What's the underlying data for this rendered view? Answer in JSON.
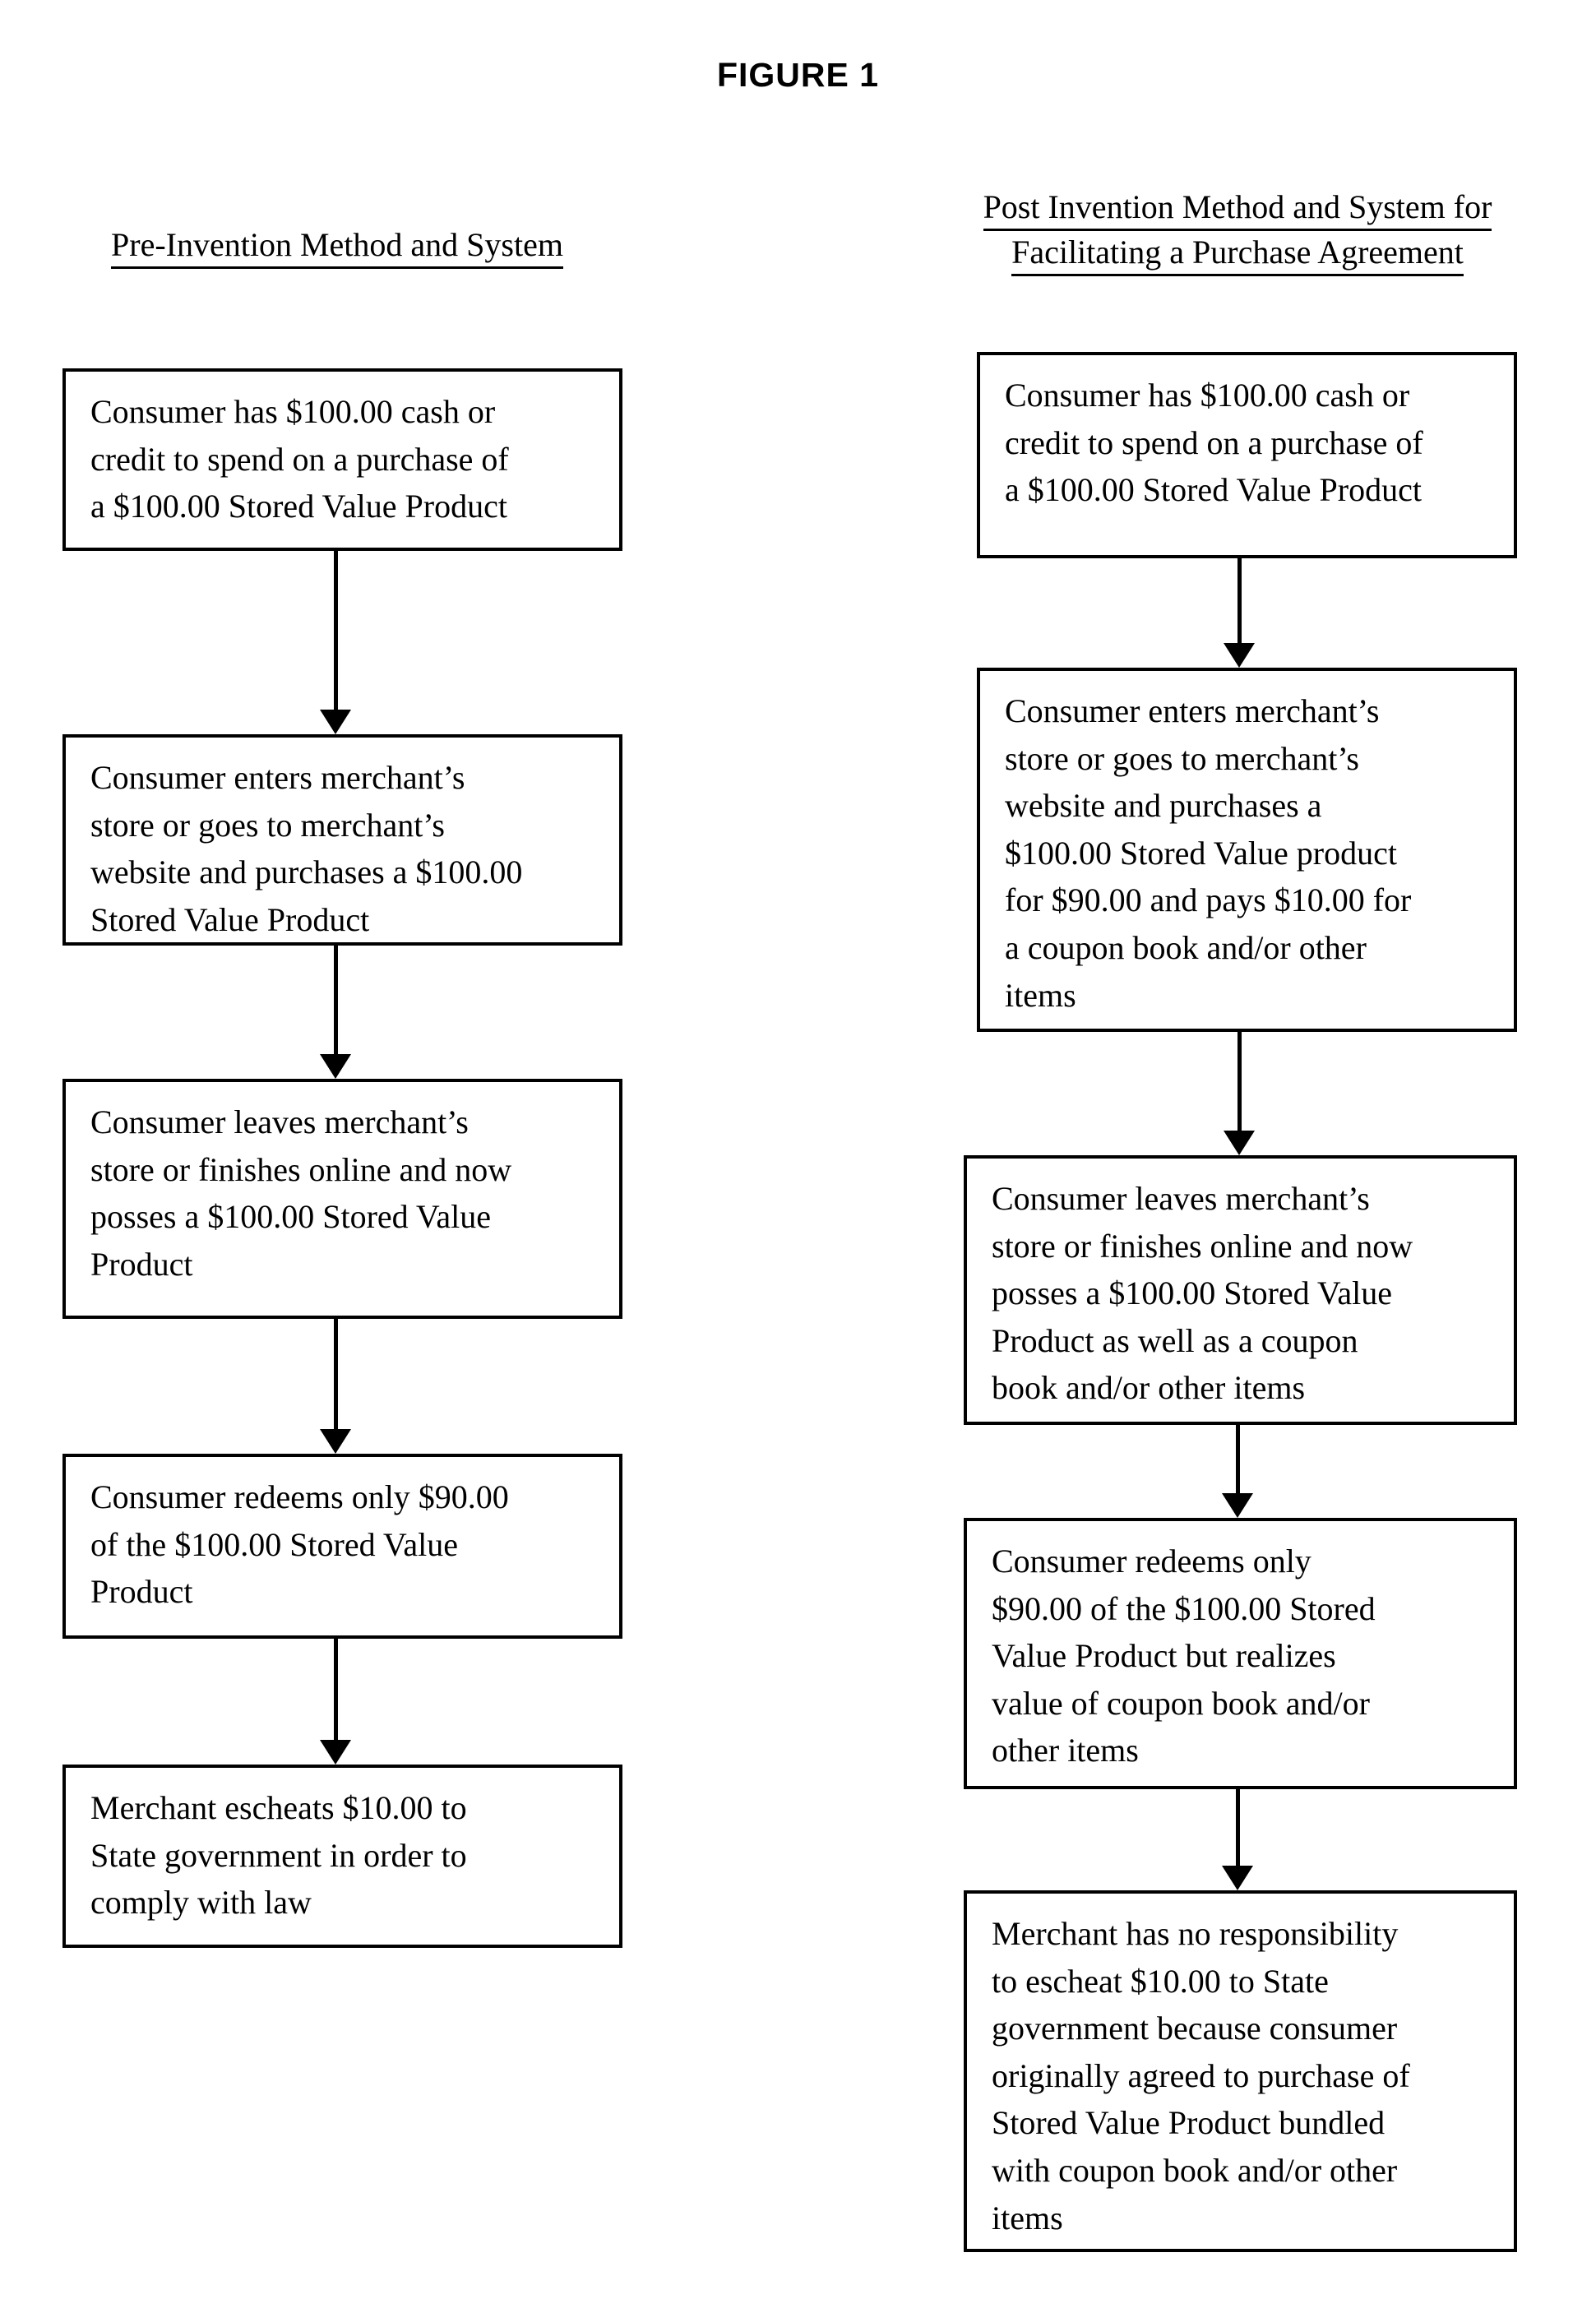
{
  "figure": {
    "title": "FIGURE 1"
  },
  "columns": {
    "left": {
      "heading_line1": "Pre-Invention Method and System",
      "steps": [
        {
          "id": "left-step-1",
          "text": "Consumer has $100.00 cash or\ncredit to spend on a purchase of\na $100.00 Stored Value Product"
        },
        {
          "id": "left-step-2",
          "text": "Consumer enters merchant’s\nstore or goes to merchant’s\nwebsite and purchases a $100.00\nStored Value Product"
        },
        {
          "id": "left-step-3",
          "text": "Consumer leaves merchant’s\nstore or finishes online and now\nposses a $100.00 Stored Value\nProduct"
        },
        {
          "id": "left-step-4",
          "text": "Consumer redeems only $90.00\nof the $100.00 Stored Value\nProduct"
        },
        {
          "id": "left-step-5",
          "text": "Merchant escheats $10.00 to\nState government in order to\ncomply with law"
        }
      ]
    },
    "right": {
      "heading_line1": "Post Invention Method and System for",
      "heading_line2": "Facilitating a Purchase Agreement",
      "steps": [
        {
          "id": "right-step-1",
          "text": "Consumer has $100.00 cash or\ncredit to spend on a purchase of\na $100.00 Stored Value Product"
        },
        {
          "id": "right-step-2",
          "text": "Consumer enters merchant’s\nstore or goes to merchant’s\nwebsite and purchases a\n$100.00 Stored Value product\nfor $90.00 and pays $10.00 for\na coupon book and/or other\nitems"
        },
        {
          "id": "right-step-3",
          "text": "Consumer leaves merchant’s\nstore or finishes online and now\nposses a $100.00 Stored Value\nProduct as well as a coupon\nbook and/or other items"
        },
        {
          "id": "right-step-4",
          "text": "Consumer redeems only\n$90.00 of the $100.00 Stored\nValue Product but realizes\nvalue of coupon book and/or\nother items"
        },
        {
          "id": "right-step-5",
          "text": "Merchant has no responsibility\nto escheat $10.00 to State\ngovernment because consumer\noriginally agreed to purchase of\nStored Value Product bundled\nwith coupon book and/or other\nitems"
        }
      ]
    }
  }
}
